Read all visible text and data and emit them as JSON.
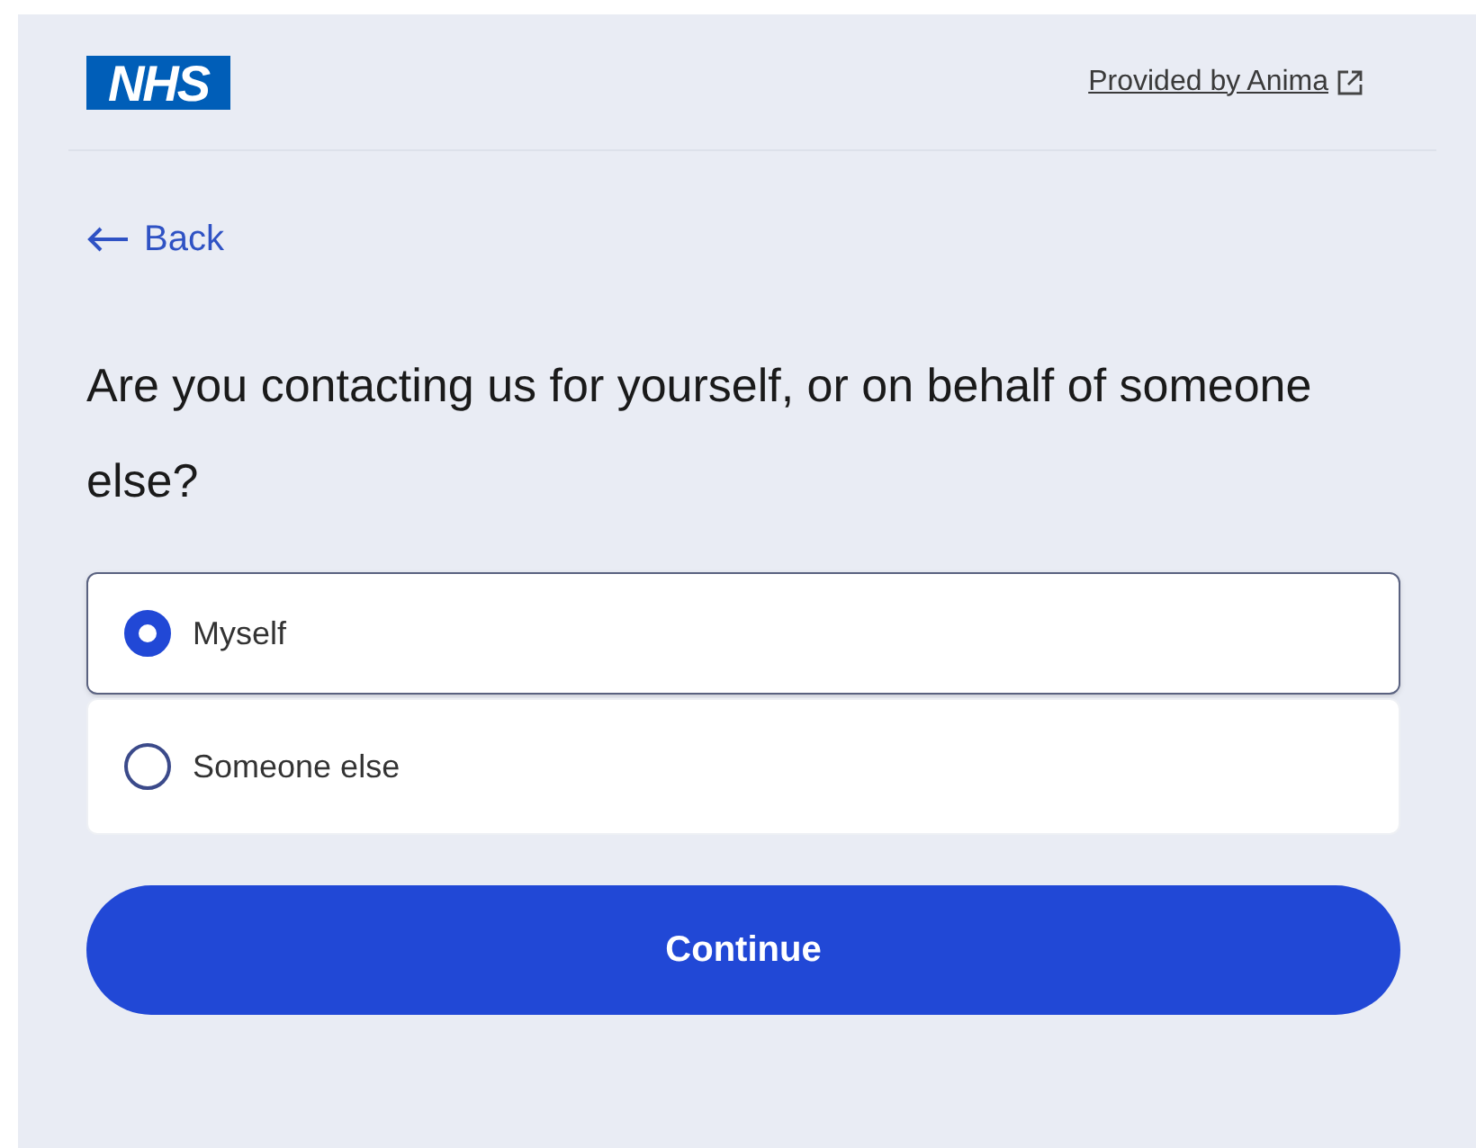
{
  "header": {
    "logo": "NHS",
    "provider_link": "Provided by Anima"
  },
  "back_link": "Back",
  "question": "Are you contacting us for yourself, or on behalf of someone else?",
  "options": [
    {
      "label": "Myself",
      "selected": true
    },
    {
      "label": "Someone else",
      "selected": false
    }
  ],
  "continue_button": "Continue"
}
